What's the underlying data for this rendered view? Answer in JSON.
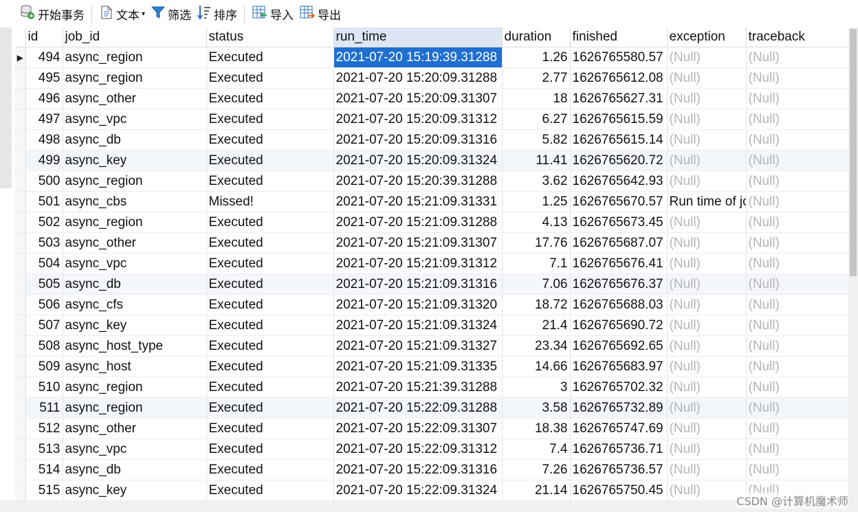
{
  "toolbar": {
    "begin_transaction": "开始事务",
    "text": "文本",
    "filter": "筛选",
    "sort": "排序",
    "import": "导入",
    "export": "导出"
  },
  "columns": [
    "id",
    "job_id",
    "status",
    "run_time",
    "duration",
    "finished",
    "exception",
    "traceback"
  ],
  "selected_column": "run_time",
  "rows": [
    {
      "id": "494",
      "job_id": "async_region",
      "status": "Executed",
      "run_time": "2021-07-20 15:19:39.31288",
      "duration": "1.26",
      "finished": "1626765580.57",
      "exception": "(Null)",
      "traceback": "(Null)"
    },
    {
      "id": "495",
      "job_id": "async_region",
      "status": "Executed",
      "run_time": "2021-07-20 15:20:09.31288",
      "duration": "2.77",
      "finished": "1626765612.08",
      "exception": "(Null)",
      "traceback": "(Null)"
    },
    {
      "id": "496",
      "job_id": "async_other",
      "status": "Executed",
      "run_time": "2021-07-20 15:20:09.31307",
      "duration": "18",
      "finished": "1626765627.31",
      "exception": "(Null)",
      "traceback": "(Null)"
    },
    {
      "id": "497",
      "job_id": "async_vpc",
      "status": "Executed",
      "run_time": "2021-07-20 15:20:09.31312",
      "duration": "6.27",
      "finished": "1626765615.59",
      "exception": "(Null)",
      "traceback": "(Null)"
    },
    {
      "id": "498",
      "job_id": "async_db",
      "status": "Executed",
      "run_time": "2021-07-20 15:20:09.31316",
      "duration": "5.82",
      "finished": "1626765615.14",
      "exception": "(Null)",
      "traceback": "(Null)"
    },
    {
      "id": "499",
      "job_id": "async_key",
      "status": "Executed",
      "run_time": "2021-07-20 15:20:09.31324",
      "duration": "11.41",
      "finished": "1626765620.72",
      "exception": "(Null)",
      "traceback": "(Null)"
    },
    {
      "id": "500",
      "job_id": "async_region",
      "status": "Executed",
      "run_time": "2021-07-20 15:20:39.31288",
      "duration": "3.62",
      "finished": "1626765642.93",
      "exception": "(Null)",
      "traceback": "(Null)"
    },
    {
      "id": "501",
      "job_id": "async_cbs",
      "status": "Missed!",
      "run_time": "2021-07-20 15:21:09.31331",
      "duration": "1.25",
      "finished": "1626765670.57",
      "exception": "Run time of jo",
      "traceback": "(Null)"
    },
    {
      "id": "502",
      "job_id": "async_region",
      "status": "Executed",
      "run_time": "2021-07-20 15:21:09.31288",
      "duration": "4.13",
      "finished": "1626765673.45",
      "exception": "(Null)",
      "traceback": "(Null)"
    },
    {
      "id": "503",
      "job_id": "async_other",
      "status": "Executed",
      "run_time": "2021-07-20 15:21:09.31307",
      "duration": "17.76",
      "finished": "1626765687.07",
      "exception": "(Null)",
      "traceback": "(Null)"
    },
    {
      "id": "504",
      "job_id": "async_vpc",
      "status": "Executed",
      "run_time": "2021-07-20 15:21:09.31312",
      "duration": "7.1",
      "finished": "1626765676.41",
      "exception": "(Null)",
      "traceback": "(Null)"
    },
    {
      "id": "505",
      "job_id": "async_db",
      "status": "Executed",
      "run_time": "2021-07-20 15:21:09.31316",
      "duration": "7.06",
      "finished": "1626765676.37",
      "exception": "(Null)",
      "traceback": "(Null)"
    },
    {
      "id": "506",
      "job_id": "async_cfs",
      "status": "Executed",
      "run_time": "2021-07-20 15:21:09.31320",
      "duration": "18.72",
      "finished": "1626765688.03",
      "exception": "(Null)",
      "traceback": "(Null)"
    },
    {
      "id": "507",
      "job_id": "async_key",
      "status": "Executed",
      "run_time": "2021-07-20 15:21:09.31324",
      "duration": "21.4",
      "finished": "1626765690.72",
      "exception": "(Null)",
      "traceback": "(Null)"
    },
    {
      "id": "508",
      "job_id": "async_host_type",
      "status": "Executed",
      "run_time": "2021-07-20 15:21:09.31327",
      "duration": "23.34",
      "finished": "1626765692.65",
      "exception": "(Null)",
      "traceback": "(Null)"
    },
    {
      "id": "509",
      "job_id": "async_host",
      "status": "Executed",
      "run_time": "2021-07-20 15:21:09.31335",
      "duration": "14.66",
      "finished": "1626765683.97",
      "exception": "(Null)",
      "traceback": "(Null)"
    },
    {
      "id": "510",
      "job_id": "async_region",
      "status": "Executed",
      "run_time": "2021-07-20 15:21:39.31288",
      "duration": "3",
      "finished": "1626765702.32",
      "exception": "(Null)",
      "traceback": "(Null)"
    },
    {
      "id": "511",
      "job_id": "async_region",
      "status": "Executed",
      "run_time": "2021-07-20 15:22:09.31288",
      "duration": "3.58",
      "finished": "1626765732.89",
      "exception": "(Null)",
      "traceback": "(Null)"
    },
    {
      "id": "512",
      "job_id": "async_other",
      "status": "Executed",
      "run_time": "2021-07-20 15:22:09.31307",
      "duration": "18.38",
      "finished": "1626765747.69",
      "exception": "(Null)",
      "traceback": "(Null)"
    },
    {
      "id": "513",
      "job_id": "async_vpc",
      "status": "Executed",
      "run_time": "2021-07-20 15:22:09.31312",
      "duration": "7.4",
      "finished": "1626765736.71",
      "exception": "(Null)",
      "traceback": "(Null)"
    },
    {
      "id": "514",
      "job_id": "async_db",
      "status": "Executed",
      "run_time": "2021-07-20 15:22:09.31316",
      "duration": "7.26",
      "finished": "1626765736.57",
      "exception": "(Null)",
      "traceback": "(Null)"
    },
    {
      "id": "515",
      "job_id": "async_key",
      "status": "Executed",
      "run_time": "2021-07-20 15:22:09.31324",
      "duration": "21.14",
      "finished": "1626765750.45",
      "exception": "(Null)",
      "traceback": "(Null)"
    }
  ],
  "watermark": "CSDN @计算机魔术师",
  "colors": {
    "selection": "#1f6fd0",
    "header_selected": "#dce6f4",
    "null_text": "#b4b4b4",
    "alt_row": "#f3f7fc"
  },
  "icons": [
    "database-transaction-icon",
    "text-document-icon",
    "filter-funnel-icon",
    "sort-icon",
    "import-table-icon",
    "export-table-icon",
    "row-pointer-icon"
  ]
}
